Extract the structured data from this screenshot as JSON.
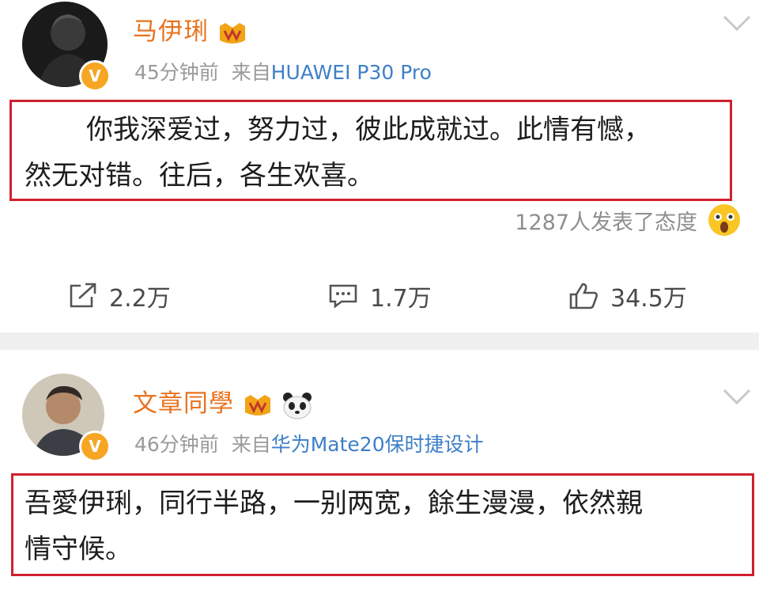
{
  "posts": [
    {
      "username": "马伊琍",
      "time": "45分钟前",
      "source_prefix": "来自",
      "source_device": "HUAWEI P30 Pro",
      "content_line1": "你我深爱过，努力过，彼此成就过。此情有憾，",
      "content_line2": "然无对错。往后，各生欢喜。",
      "reactions_text": "1287人发表了态度",
      "actions": {
        "share": "2.2万",
        "comment": "1.7万",
        "like": "34.5万"
      }
    },
    {
      "username": "文章同學",
      "time": "46分钟前",
      "source_prefix": "来自",
      "source_device": "华为Mate20保时捷设计",
      "content_line1": "吾愛伊琍，同行半路，一别两宽，餘生漫漫，依然親",
      "content_line2": "情守候。"
    }
  ],
  "colors": {
    "username": "#e8731f",
    "link": "#3d7fc8",
    "highlight_border": "#d0202d",
    "verified": "#f6a623"
  },
  "icons": [
    "verified-badge-icon",
    "gold-member-badge-icon",
    "panda-emoji-icon",
    "chevron-down-icon",
    "share-icon",
    "comment-icon",
    "like-icon",
    "shocked-face-icon"
  ]
}
